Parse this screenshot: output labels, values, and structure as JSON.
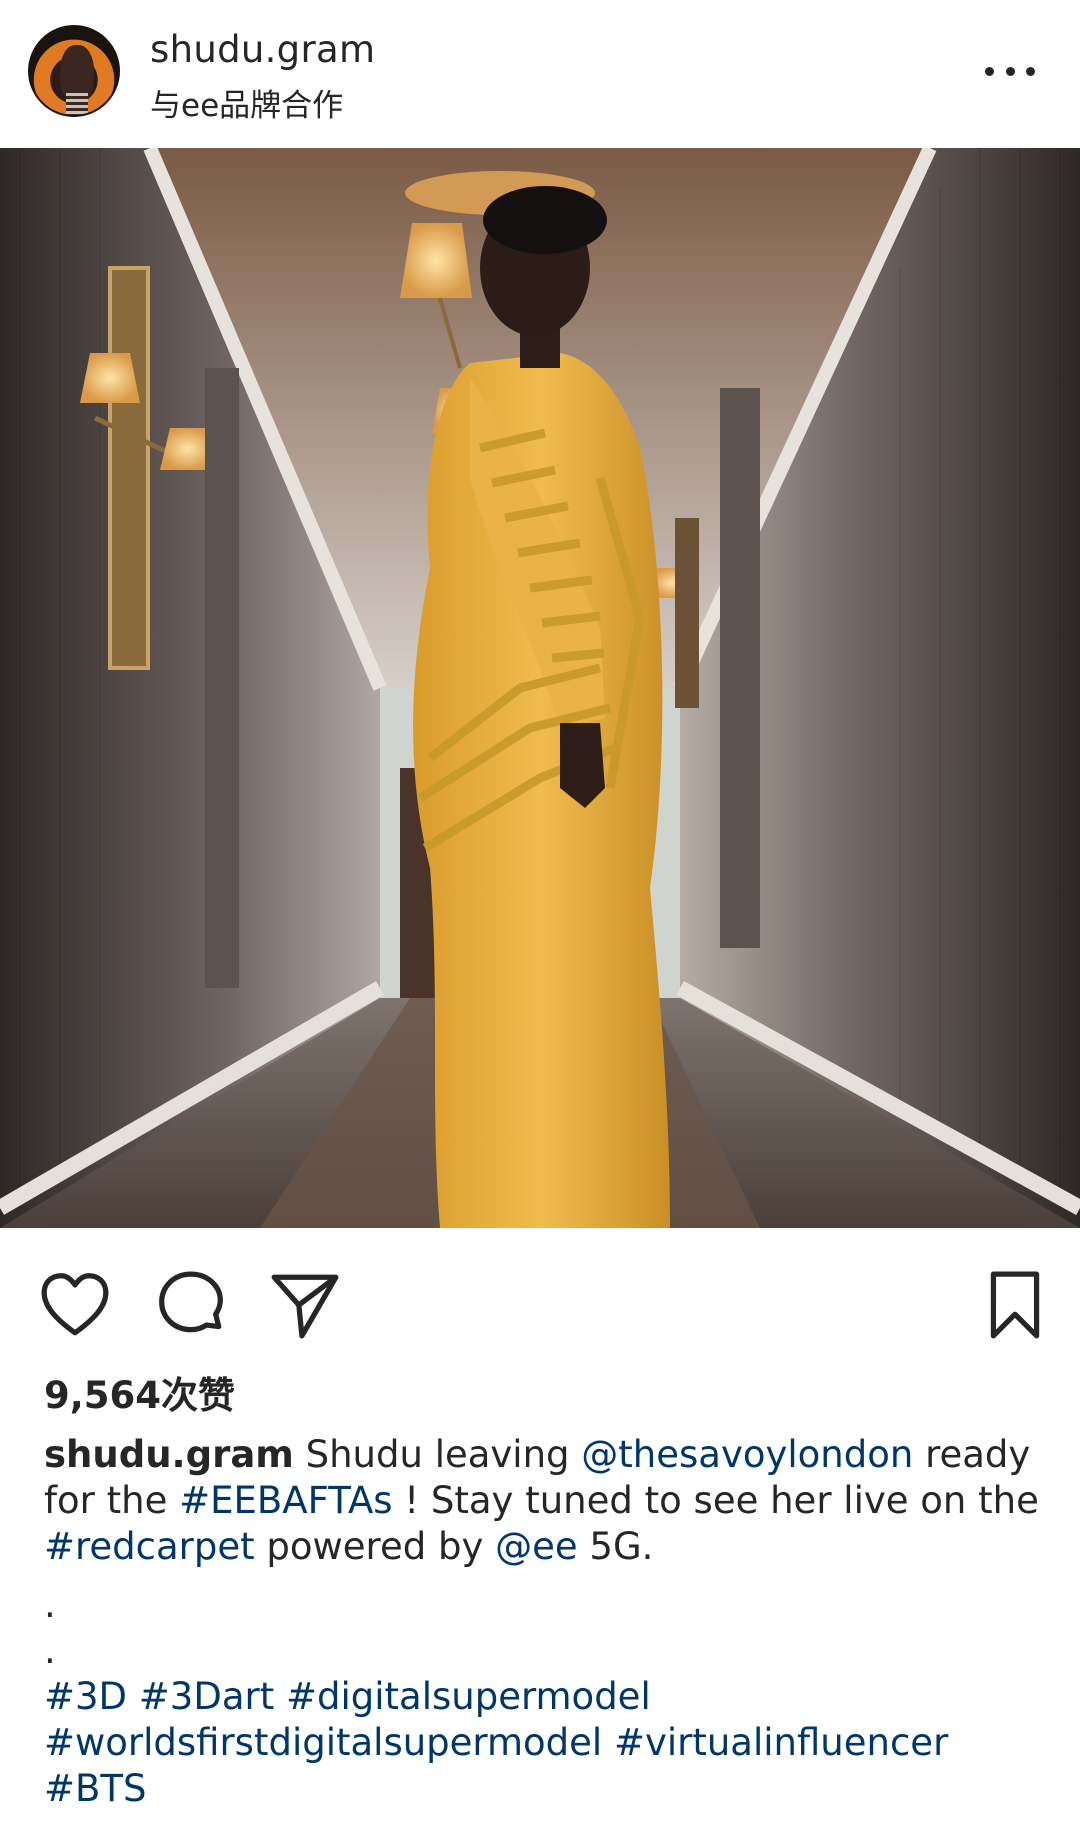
{
  "header": {
    "username": "shudu.gram",
    "subtitle": "与ee品牌合作",
    "more_icon": "more-horizontal-icon"
  },
  "photo": {
    "colors": {
      "dress": "#e9b340",
      "dress_trim": "#c79a2a",
      "wall": "#8a7f7b",
      "lamp": "#f2c16b"
    }
  },
  "actions": {
    "like_icon": "heart-icon",
    "comment_icon": "comment-icon",
    "share_icon": "send-icon",
    "save_icon": "bookmark-icon"
  },
  "likes": "9,564次赞",
  "caption": {
    "username": "shudu.gram",
    "text_1": " Shudu leaving ",
    "mention_1": "@thesavoylondon",
    "text_2": " ready for the ",
    "hashtag_1": "#EEBAFTAs",
    "text_3": " ! Stay tuned to see her live on the ",
    "hashtag_2": "#redcarpet",
    "text_4": " powered by ",
    "mention_2": "@ee",
    "text_5": " 5G.",
    "dot_1": ".",
    "dot_2": ".",
    "hashtags_line_1": "#3D #3Dart #digitalsupermodel",
    "hashtags_line_2": "#worldsfirstdigitalsupermodel #virtualinfluencer",
    "hashtags_line_3": "#BTS"
  },
  "colors": {
    "link": "#00376b",
    "text": "#262626",
    "background": "#ffffff"
  }
}
